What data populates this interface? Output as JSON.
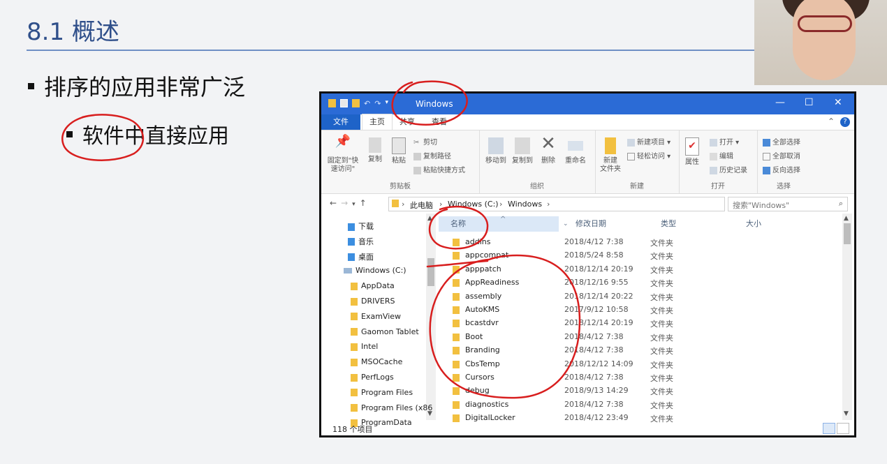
{
  "slide": {
    "title": "8.1 概述",
    "bullet1": "排序的应用非常广泛",
    "bullet2": "软件中直接应用"
  },
  "window": {
    "title": "Windows",
    "controls": {
      "minimize": "—",
      "maximize": "☐",
      "close": "✕"
    }
  },
  "ribbon_tabs": {
    "file": "文件",
    "home": "主页",
    "share": "共享",
    "view": "查看"
  },
  "ribbon": {
    "clipboard": {
      "label": "剪贴板",
      "pin": "固定到\"快\n速访问\"",
      "copy": "复制",
      "paste": "粘贴",
      "cut": "剪切",
      "copy_path": "复制路径",
      "paste_shortcut": "粘贴快捷方式"
    },
    "organize": {
      "label": "组织",
      "move_to": "移动到",
      "copy_to": "复制到",
      "delete": "删除",
      "rename": "重命名"
    },
    "new": {
      "label": "新建",
      "new_folder": "新建\n文件夹",
      "new_item": "新建项目 ▾",
      "easy_access": "轻松访问 ▾"
    },
    "open": {
      "label": "打开",
      "properties": "属性",
      "open": "打开 ▾",
      "edit": "编辑",
      "history": "历史记录"
    },
    "select": {
      "label": "选择",
      "select_all": "全部选择",
      "select_none": "全部取消",
      "invert": "反向选择"
    }
  },
  "address": {
    "crumbs": [
      "此电脑",
      "Windows (C:)",
      "Windows"
    ],
    "search_placeholder": "搜索\"Windows\""
  },
  "nav": [
    {
      "label": "下载",
      "indent": 0
    },
    {
      "label": "音乐",
      "indent": 0
    },
    {
      "label": "桌面",
      "indent": 0
    },
    {
      "label": "Windows (C:)",
      "indent": -1
    },
    {
      "label": "AppData",
      "indent": 1
    },
    {
      "label": "DRIVERS",
      "indent": 1
    },
    {
      "label": "ExamView",
      "indent": 1
    },
    {
      "label": "Gaomon Tablet",
      "indent": 1
    },
    {
      "label": "Intel",
      "indent": 1
    },
    {
      "label": "MSOCache",
      "indent": 1
    },
    {
      "label": "PerfLogs",
      "indent": 1
    },
    {
      "label": "Program Files",
      "indent": 1
    },
    {
      "label": "Program Files (x86",
      "indent": 1
    },
    {
      "label": "ProgramData",
      "indent": 1
    }
  ],
  "columns": {
    "name": "名称",
    "date": "修改日期",
    "type": "类型",
    "size": "大小"
  },
  "files": [
    {
      "name": "addins",
      "date": "2018/4/12 7:38",
      "type": "文件夹"
    },
    {
      "name": "appcompat",
      "date": "2018/5/24 8:58",
      "type": "文件夹"
    },
    {
      "name": "apppatch",
      "date": "2018/12/14 20:19",
      "type": "文件夹"
    },
    {
      "name": "AppReadiness",
      "date": "2018/12/16 9:55",
      "type": "文件夹"
    },
    {
      "name": "assembly",
      "date": "2018/12/14 20:22",
      "type": "文件夹"
    },
    {
      "name": "AutoKMS",
      "date": "2017/9/12 10:58",
      "type": "文件夹"
    },
    {
      "name": "bcastdvr",
      "date": "2018/12/14 20:19",
      "type": "文件夹"
    },
    {
      "name": "Boot",
      "date": "2018/4/12 7:38",
      "type": "文件夹"
    },
    {
      "name": "Branding",
      "date": "2018/4/12 7:38",
      "type": "文件夹"
    },
    {
      "name": "CbsTemp",
      "date": "2018/12/12 14:09",
      "type": "文件夹"
    },
    {
      "name": "Cursors",
      "date": "2018/4/12 7:38",
      "type": "文件夹"
    },
    {
      "name": "debug",
      "date": "2018/9/13 14:29",
      "type": "文件夹"
    },
    {
      "name": "diagnostics",
      "date": "2018/4/12 7:38",
      "type": "文件夹"
    },
    {
      "name": "DigitalLocker",
      "date": "2018/4/12 23:49",
      "type": "文件夹"
    }
  ],
  "status": "118 个项目",
  "colors": {
    "accent": "#2b6bd6",
    "folder": "#f2c040",
    "annotation": "#d81e1e"
  }
}
